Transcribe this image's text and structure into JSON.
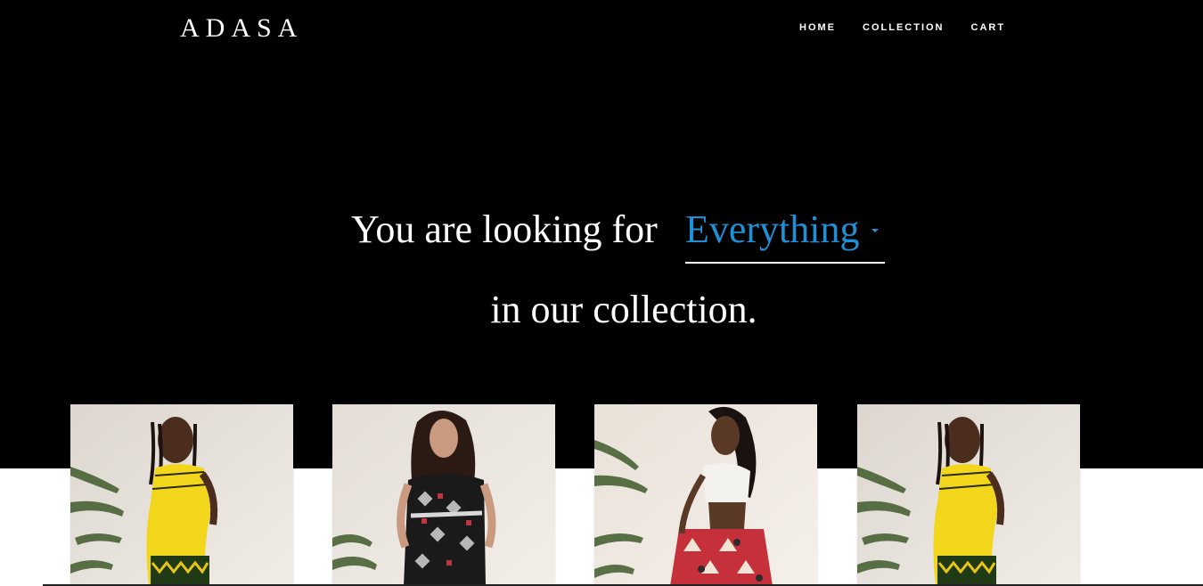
{
  "header": {
    "logo": "ADASA",
    "nav": [
      {
        "label": "HOME"
      },
      {
        "label": "COLLECTION"
      },
      {
        "label": "CART"
      }
    ]
  },
  "hero": {
    "lead_text": "You are looking for",
    "filter_selected": "Everything",
    "trailing_text": "in our collection."
  },
  "colors": {
    "hero_background": "#000000",
    "accent": "#1e90d6",
    "text": "#ffffff"
  },
  "products": [
    {
      "image": "model-yellow-dress-back"
    },
    {
      "image": "model-geometric-print-jumpsuit"
    },
    {
      "image": "model-white-top-red-print-skirt"
    },
    {
      "image": "model-yellow-dress-back"
    }
  ]
}
